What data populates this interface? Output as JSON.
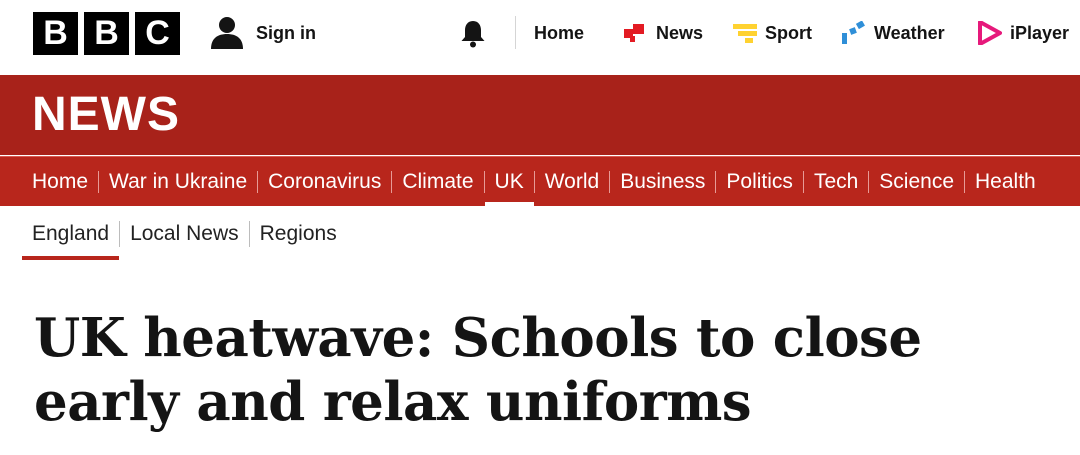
{
  "header": {
    "logo_letters": [
      "B",
      "B",
      "C"
    ],
    "signin_label": "Sign in",
    "notifications_icon": "bell-icon",
    "nav": [
      {
        "label": "Home",
        "icon": "none"
      },
      {
        "label": "News",
        "icon": "news-icon",
        "color": "#e31b23"
      },
      {
        "label": "Sport",
        "icon": "sport-icon",
        "color": "#ffd230"
      },
      {
        "label": "Weather",
        "icon": "weather-icon",
        "color": "#2f8fd8"
      },
      {
        "label": "iPlayer",
        "icon": "iplayer-icon",
        "color": "#e6197b"
      }
    ]
  },
  "brand": {
    "title": "NEWS",
    "band_color": "#a8221a"
  },
  "section_nav": {
    "items": [
      "Home",
      "War in Ukraine",
      "Coronavirus",
      "Climate",
      "UK",
      "World",
      "Business",
      "Politics",
      "Tech",
      "Science",
      "Health"
    ],
    "active": "UK"
  },
  "sub_nav": {
    "items": [
      "England",
      "Local News",
      "Regions"
    ],
    "active": "England"
  },
  "article": {
    "headline": "UK heatwave: Schools to close early and relax uniforms"
  }
}
